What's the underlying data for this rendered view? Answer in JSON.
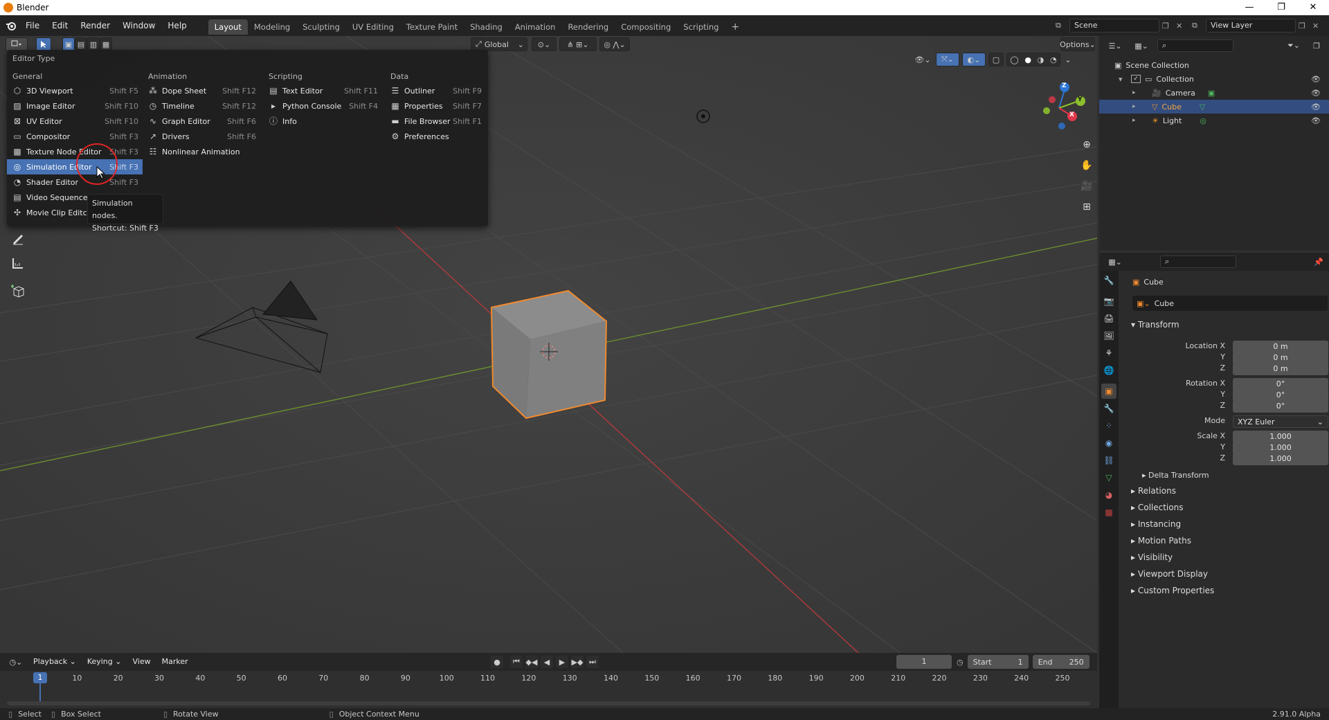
{
  "window": {
    "title": "Blender",
    "controls": [
      "—",
      "❐",
      "✕"
    ]
  },
  "menu": [
    "File",
    "Edit",
    "Render",
    "Window",
    "Help"
  ],
  "workspaces": [
    "Layout",
    "Modeling",
    "Sculpting",
    "UV Editing",
    "Texture Paint",
    "Shading",
    "Animation",
    "Rendering",
    "Compositing",
    "Scripting"
  ],
  "add_tab": "+",
  "scene": "Scene",
  "view_layer": "View Layer",
  "viewport": {
    "orientation": "Global",
    "options": "Options",
    "gizmo": {
      "x": "X",
      "y": "Y",
      "z": "Z"
    }
  },
  "editor_type_popup": {
    "title": "Editor Type",
    "columns": [
      {
        "heading": "General",
        "items": [
          {
            "label": "3D Viewport",
            "shortcut": "Shift F5",
            "icon": "cube-icon"
          },
          {
            "label": "Image Editor",
            "shortcut": "Shift F10",
            "icon": "image-icon"
          },
          {
            "label": "UV Editor",
            "shortcut": "Shift F10",
            "icon": "uv-icon"
          },
          {
            "label": "Compositor",
            "shortcut": "Shift F3",
            "icon": "node-icon"
          },
          {
            "label": "Texture Node Editor",
            "shortcut": "Shift F3",
            "icon": "texture-icon"
          },
          {
            "label": "Simulation Editor",
            "shortcut": "Shift F3",
            "icon": "simulation-icon"
          },
          {
            "label": "Shader Editor",
            "shortcut": "Shift F3",
            "icon": "shader-icon"
          },
          {
            "label": "Video Sequence",
            "shortcut": "",
            "icon": "sequence-icon"
          },
          {
            "label": "Movie Clip Editc",
            "shortcut": "",
            "icon": "movie-clip-icon"
          }
        ]
      },
      {
        "heading": "Animation",
        "items": [
          {
            "label": "Dope Sheet",
            "shortcut": "Shift F12",
            "icon": "dopesheet-icon"
          },
          {
            "label": "Timeline",
            "shortcut": "Shift F12",
            "icon": "timeline-icon"
          },
          {
            "label": "Graph Editor",
            "shortcut": "Shift F6",
            "icon": "graph-icon"
          },
          {
            "label": "Drivers",
            "shortcut": "Shift F6",
            "icon": "drivers-icon"
          },
          {
            "label": "Nonlinear Animation",
            "shortcut": "",
            "icon": "nla-icon"
          }
        ]
      },
      {
        "heading": "Scripting",
        "items": [
          {
            "label": "Text Editor",
            "shortcut": "Shift F11",
            "icon": "text-icon"
          },
          {
            "label": "Python Console",
            "shortcut": "Shift F4",
            "icon": "console-icon"
          },
          {
            "label": "Info",
            "shortcut": "",
            "icon": "info-icon"
          }
        ]
      },
      {
        "heading": "Data",
        "items": [
          {
            "label": "Outliner",
            "shortcut": "Shift F9",
            "icon": "outliner-icon"
          },
          {
            "label": "Properties",
            "shortcut": "Shift F7",
            "icon": "properties-icon"
          },
          {
            "label": "File Browser",
            "shortcut": "Shift F1",
            "icon": "file-browser-icon"
          },
          {
            "label": "Preferences",
            "shortcut": "",
            "icon": "preferences-icon"
          }
        ]
      }
    ],
    "tooltip": {
      "line1": "Simulation nodes.",
      "line2": "Shortcut: Shift F3"
    }
  },
  "outliner": {
    "items": [
      {
        "label": "Scene Collection",
        "indent": 0
      },
      {
        "label": "Collection",
        "indent": 1
      },
      {
        "label": "Camera",
        "indent": 2
      },
      {
        "label": "Cube",
        "indent": 2,
        "selected": true
      },
      {
        "label": "Light",
        "indent": 2
      }
    ]
  },
  "properties": {
    "object_name": "Cube",
    "name_field": "Cube",
    "transform_header": "Transform",
    "location": {
      "label": "Location X",
      "x": "0 m",
      "y": "0 m",
      "z": "0 m"
    },
    "rotation": {
      "label": "Rotation X",
      "x": "0°",
      "y": "0°",
      "z": "0°"
    },
    "mode_label": "Mode",
    "mode_value": "XYZ Euler",
    "scale": {
      "label": "Scale X",
      "x": "1.000",
      "y": "1.000",
      "z": "1.000"
    },
    "axis_y": "Y",
    "axis_z": "Z",
    "delta_transform": "Delta Transform",
    "sections": [
      "Relations",
      "Collections",
      "Instancing",
      "Motion Paths",
      "Visibility",
      "Viewport Display",
      "Custom Properties"
    ]
  },
  "timeline": {
    "menus": [
      "Playback",
      "Keying",
      "View",
      "Marker"
    ],
    "current_frame": "1",
    "start_label": "Start",
    "start": "1",
    "end_label": "End",
    "end": "250",
    "ticks": [
      "1",
      "10",
      "20",
      "30",
      "40",
      "50",
      "60",
      "70",
      "80",
      "90",
      "100",
      "110",
      "120",
      "130",
      "140",
      "150",
      "160",
      "170",
      "180",
      "190",
      "200",
      "210",
      "220",
      "230",
      "240",
      "250"
    ]
  },
  "statusbar": {
    "select": "Select",
    "box_select": "Box Select",
    "rotate_view": "Rotate View",
    "context_menu": "Object Context Menu",
    "version": "2.91.0 Alpha"
  },
  "colors": {
    "accent": "#4772b3",
    "selection_orange": "#f08a2e",
    "x_axis": "#b33a3a",
    "y_axis": "#6a8f2f"
  }
}
